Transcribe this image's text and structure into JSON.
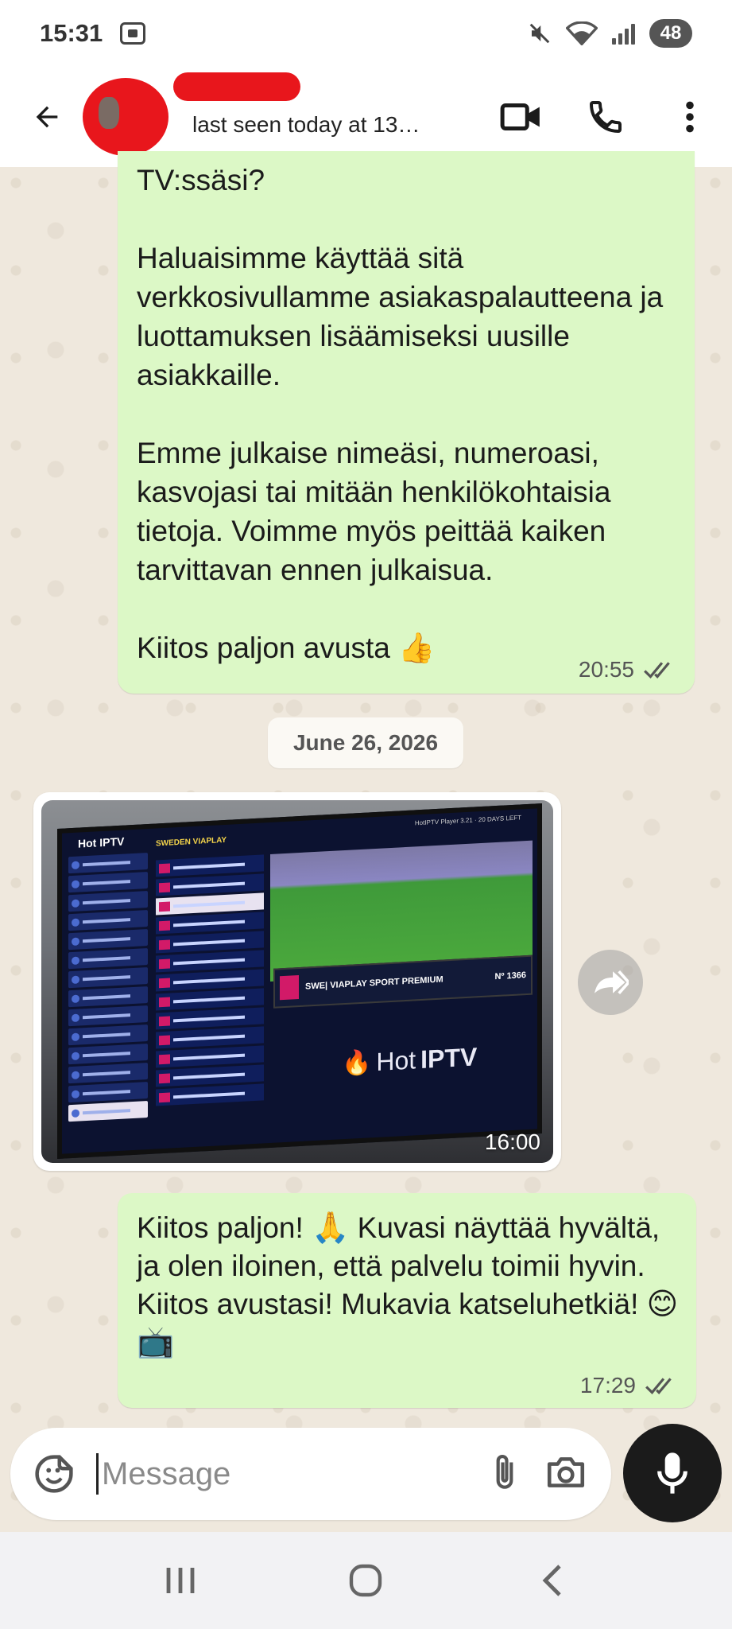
{
  "status_bar": {
    "time": "15:31",
    "battery": "48",
    "icons": [
      "screenshot-icon",
      "mute-icon",
      "wifi-icon",
      "signal-icon"
    ]
  },
  "header": {
    "last_seen": "last seen today at 13…",
    "icons": [
      "back-arrow-icon",
      "video-call-icon",
      "phone-icon",
      "more-options-icon"
    ]
  },
  "messages": [
    {
      "type": "outgoing-text",
      "paragraphs": [
        "TV:ssäsi?",
        "Haluaisimme käyttää sitä verkkosivullamme asiakaspalautteena ja luottamuksen lisäämiseksi uusille asiakkaille.",
        "Emme julkaise nimeäsi, numeroasi, kasvojasi tai mitään henkilökohtaisia tietoja. Voimme myös peittää kaiken tarvittavan ennen julkaisua.",
        "Kiitos paljon avusta 👍"
      ],
      "time": "20:55",
      "status": "read"
    },
    {
      "type": "date-separator",
      "text": "June 26, 2026"
    },
    {
      "type": "incoming-image",
      "time": "16:00",
      "image": {
        "brand": "Hot IPTV",
        "category": "SWEDEN VIAPLAY",
        "top_right": "HotIPTV Player 3.21 · 20 DAYS LEFT",
        "now_playing": "SWE| VIAPLAY SPORT PREMIUM",
        "channel_number": "Nº 1366",
        "logo_light": "Hot",
        "logo_bold": "IPTV"
      }
    },
    {
      "type": "outgoing-text",
      "text_part1": "Kiitos paljon! ",
      "emoji1": "🙏",
      "text_part2": " Kuvasi näyttää hyvältä, ja olen iloinen, että palvelu toimii hyvin. Kiitos avustasi! Mukavia katseluhetkiä! ",
      "emoji2": "😊📺",
      "time": "17:29",
      "status": "read"
    }
  ],
  "composer": {
    "placeholder": "Message",
    "icons": [
      "sticker-icon",
      "attach-icon",
      "camera-icon",
      "mic-icon"
    ]
  },
  "nav_bar": {
    "icons": [
      "recents-icon",
      "home-icon",
      "back-icon"
    ]
  },
  "colors": {
    "outgoing_bubble": "#dcf8c6",
    "chat_background": "#efe8dd",
    "redaction": "#e8161c",
    "mic_button": "#1b1b1b"
  }
}
